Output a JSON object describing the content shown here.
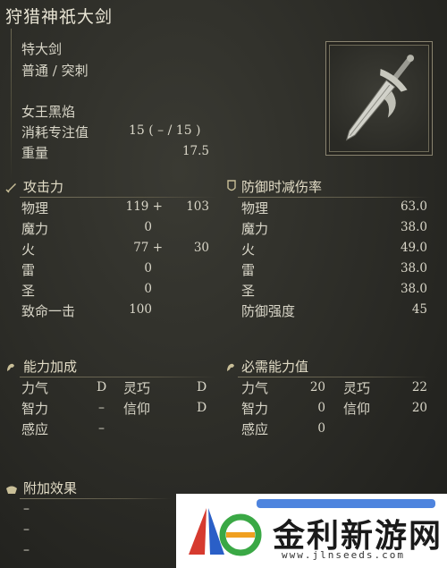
{
  "weapon": {
    "name": "狩猎神祇大剑",
    "type": "特大剑",
    "attack_type": "普通 / 突刺",
    "skill": "女王黑焰",
    "fp_cost_label": "消耗专注值",
    "fp_cost_value": "15 (   – / 15 )",
    "weight_label": "重量",
    "weight_value": "17.5"
  },
  "attack": {
    "header": "攻击力",
    "rows": [
      {
        "label": "物理",
        "base": "119 +",
        "bonus": "103"
      },
      {
        "label": "魔力",
        "base": "0",
        "bonus": ""
      },
      {
        "label": "火",
        "base": "77 +",
        "bonus": "30"
      },
      {
        "label": "雷",
        "base": "0",
        "bonus": ""
      },
      {
        "label": "圣",
        "base": "0",
        "bonus": ""
      },
      {
        "label": "致命一击",
        "base": "100",
        "bonus": ""
      }
    ]
  },
  "guard": {
    "header": "防御时减伤率",
    "rows": [
      {
        "label": "物理",
        "value": "63.0"
      },
      {
        "label": "魔力",
        "value": "38.0"
      },
      {
        "label": "火",
        "value": "49.0"
      },
      {
        "label": "雷",
        "value": "38.0"
      },
      {
        "label": "圣",
        "value": "38.0"
      },
      {
        "label": "防御强度",
        "value": "45"
      }
    ]
  },
  "scaling": {
    "header": "能力加成",
    "rows": [
      {
        "l1": "力气",
        "v1": "D",
        "l2": "灵巧",
        "v2": "D"
      },
      {
        "l1": "智力",
        "v1": "–",
        "l2": "信仰",
        "v2": "D"
      },
      {
        "l1": "感应",
        "v1": "–",
        "l2": "",
        "v2": ""
      }
    ]
  },
  "requirements": {
    "header": "必需能力值",
    "rows": [
      {
        "l1": "力气",
        "v1": "20",
        "l2": "灵巧",
        "v2": "22"
      },
      {
        "l1": "智力",
        "v1": "0",
        "l2": "信仰",
        "v2": "20"
      },
      {
        "l1": "感应",
        "v1": "0",
        "l2": "",
        "v2": ""
      }
    ]
  },
  "effects": {
    "header": "附加效果",
    "items": [
      "–",
      "–",
      "–"
    ]
  },
  "watermark": {
    "text": "金利新游网",
    "url": "www.jlnseeds.com"
  },
  "colors": {
    "text": "#d9d6c8",
    "accent_gold": "#b8a878",
    "bg": "#2b2b26"
  }
}
